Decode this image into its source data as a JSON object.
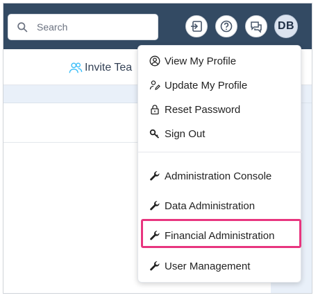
{
  "search": {
    "placeholder": "Search"
  },
  "header_icons": {
    "avatar_initials": "DB"
  },
  "subbar": {
    "invite_label": "Invite Tea"
  },
  "user_menu": {
    "items": [
      {
        "label": "View My Profile",
        "icon": "user-circle-icon"
      },
      {
        "label": "Update My Profile",
        "icon": "user-edit-icon"
      },
      {
        "label": "Reset Password",
        "icon": "lock-icon"
      },
      {
        "label": "Sign Out",
        "icon": "key-icon"
      },
      {
        "label": "Administration Console",
        "icon": "wrench-icon"
      },
      {
        "label": "Data Administration",
        "icon": "wrench-icon"
      },
      {
        "label": "Financial Administration",
        "icon": "wrench-icon"
      },
      {
        "label": "User Management",
        "icon": "wrench-icon"
      }
    ],
    "highlighted_item": "Financial Administration",
    "highlight_color": "#e8357f"
  },
  "colors": {
    "topbar": "#334a63",
    "panel": "#e9f0f9"
  }
}
